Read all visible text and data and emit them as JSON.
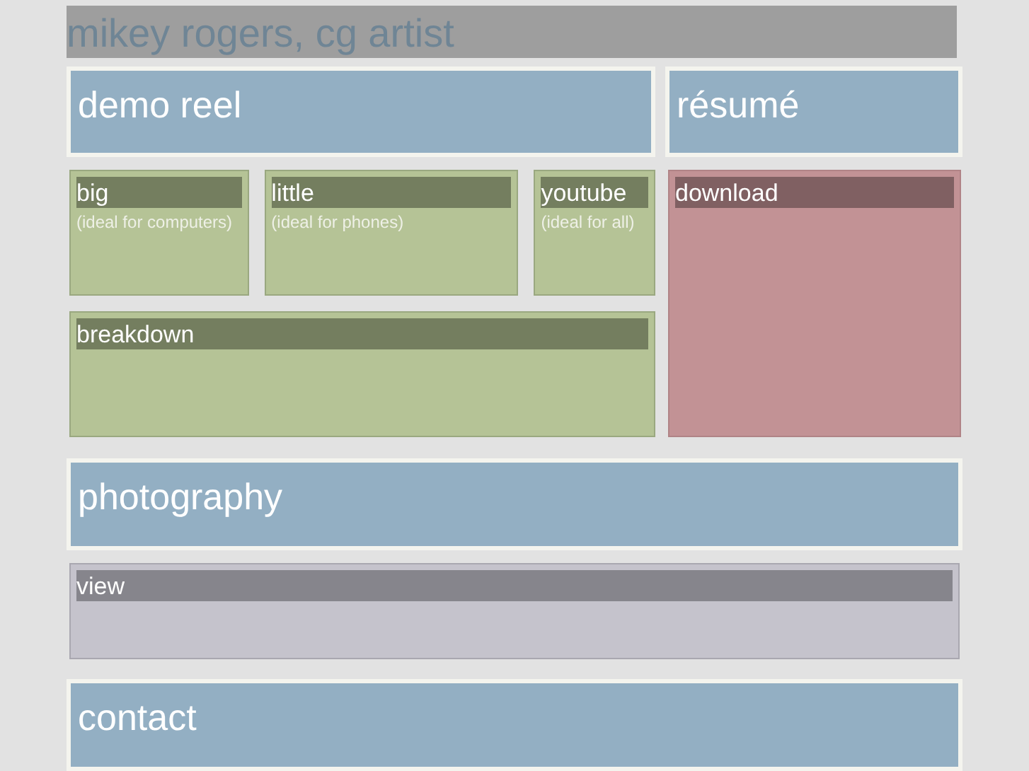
{
  "title": "mikey rogers, cg artist",
  "demo_reel": {
    "heading": "demo reel",
    "links": [
      {
        "label": "big",
        "note": "(ideal for computers)",
        "kind": "video"
      },
      {
        "label": "little",
        "note": "(ideal for phones)",
        "kind": "video"
      },
      {
        "label": "youtube",
        "note": "(ideal for all)",
        "kind": "video"
      }
    ],
    "breakdown": {
      "label": "breakdown",
      "kind": "video"
    }
  },
  "resume": {
    "heading": "résumé",
    "link": {
      "label": "download",
      "kind": "document"
    }
  },
  "photography": {
    "heading": "photography",
    "link": {
      "label": "view",
      "kind": "gallery"
    }
  },
  "contact": {
    "heading": "contact"
  }
}
